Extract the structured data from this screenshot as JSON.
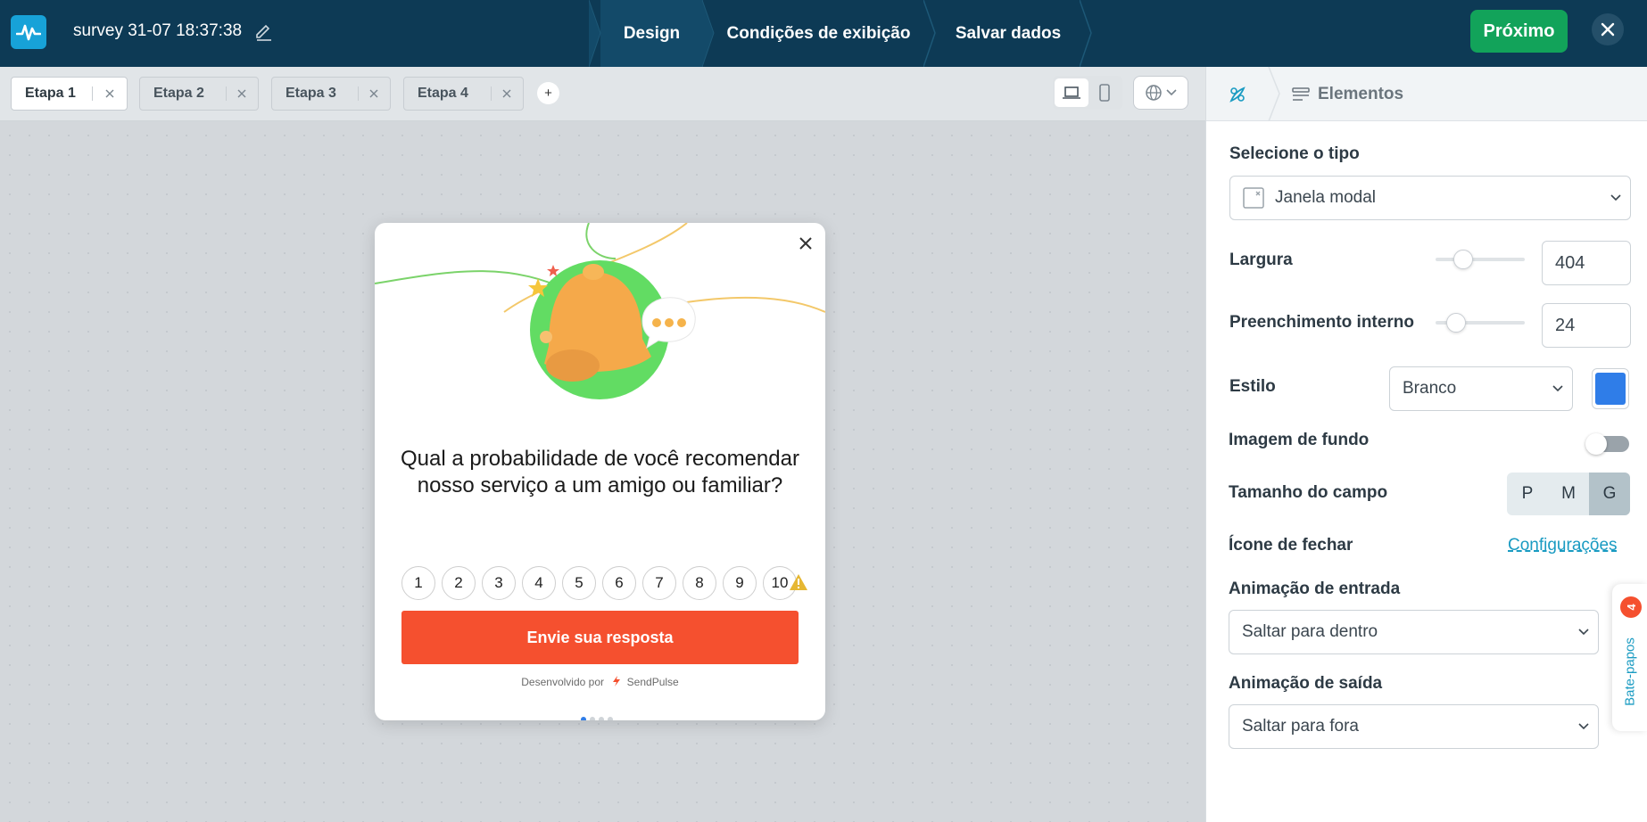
{
  "topbar": {
    "survey_title": "survey 31-07 18:37:38",
    "steps": [
      "Design",
      "Condições de exibição",
      "Salvar dados"
    ],
    "next_label": "Próximo"
  },
  "tabs": {
    "items": [
      "Etapa 1",
      "Etapa 2",
      "Etapa 3",
      "Etapa 4"
    ],
    "add_label": "+"
  },
  "modal": {
    "question": "Qual a probabilidade de você recomendar nosso serviço a um amigo ou familiar?",
    "scale": [
      "1",
      "2",
      "3",
      "4",
      "5",
      "6",
      "7",
      "8",
      "9",
      "10"
    ],
    "submit_label": "Envie sua resposta",
    "powered_by": "Desenvolvido por",
    "brand": "SendPulse"
  },
  "panel": {
    "elements_label": "Elementos",
    "select_type_label": "Selecione o tipo",
    "select_type_value": "Janela modal",
    "width_label": "Largura",
    "width_value": "404",
    "width_level": 0.25,
    "padding_label": "Preenchimento interno",
    "padding_value": "24",
    "padding_level": 0.15,
    "style_label": "Estilo",
    "style_value": "Branco",
    "style_color": "#2f7de8",
    "bg_image_label": "Imagem de fundo",
    "field_size_label": "Tamanho do campo",
    "field_sizes": [
      "P",
      "M",
      "G"
    ],
    "close_icon_label": "Ícone de fechar",
    "close_icon_link": "Configurações",
    "entry_anim_label": "Animação de entrada",
    "entry_anim_value": "Saltar para dentro",
    "exit_anim_label": "Animação de saída",
    "exit_anim_value": "Saltar para fora"
  },
  "chat": {
    "badge": "4",
    "label": "Bate-papos"
  },
  "colors": {
    "topbar": "#0d3a55",
    "next_button": "#12a35a",
    "submit_button": "#f5502f",
    "accent": "#1a9bc2"
  }
}
